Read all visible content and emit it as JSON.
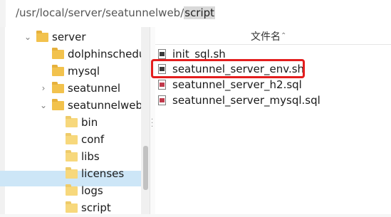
{
  "address_bar": {
    "segments": [
      "/usr/local/server/seatunnelweb/",
      "script"
    ]
  },
  "tree": {
    "items": [
      {
        "label": "server",
        "expander": "chevron-down",
        "level": 0
      },
      {
        "label": "dolphinscheduler",
        "expander": "",
        "level": 1
      },
      {
        "label": "mysql",
        "expander": "",
        "level": 1
      },
      {
        "label": "seatunnel",
        "expander": "chevron-right",
        "level": 1
      },
      {
        "label": "seatunnelweb",
        "expander": "chevron-down",
        "level": 1
      },
      {
        "label": "bin",
        "expander": "",
        "level": 2
      },
      {
        "label": "conf",
        "expander": "",
        "level": 2
      },
      {
        "label": "libs",
        "expander": "",
        "level": 2
      },
      {
        "label": "licenses",
        "expander": "",
        "level": 2
      },
      {
        "label": "logs",
        "expander": "",
        "level": 2
      },
      {
        "label": "script",
        "expander": "",
        "level": 2,
        "selected": true
      }
    ],
    "chevron_down_glyph": "⌄",
    "chevron_right_glyph": "›"
  },
  "file_list": {
    "column_header": "文件名",
    "sort_glyph": "⌃",
    "files": [
      {
        "name": "init_sql.sh",
        "icon": "shell-script-icon"
      },
      {
        "name": "seatunnel_server_env.sh",
        "icon": "shell-script-icon",
        "highlighted": true
      },
      {
        "name": "seatunnel_server_h2.sql",
        "icon": "sql-file-icon"
      },
      {
        "name": "seatunnel_server_mysql.sql",
        "icon": "sql-file-icon"
      }
    ]
  },
  "colors": {
    "highlight_border": "#e31e1e",
    "selection_bg": "#cde6f7",
    "folder": "#f2c24d"
  }
}
